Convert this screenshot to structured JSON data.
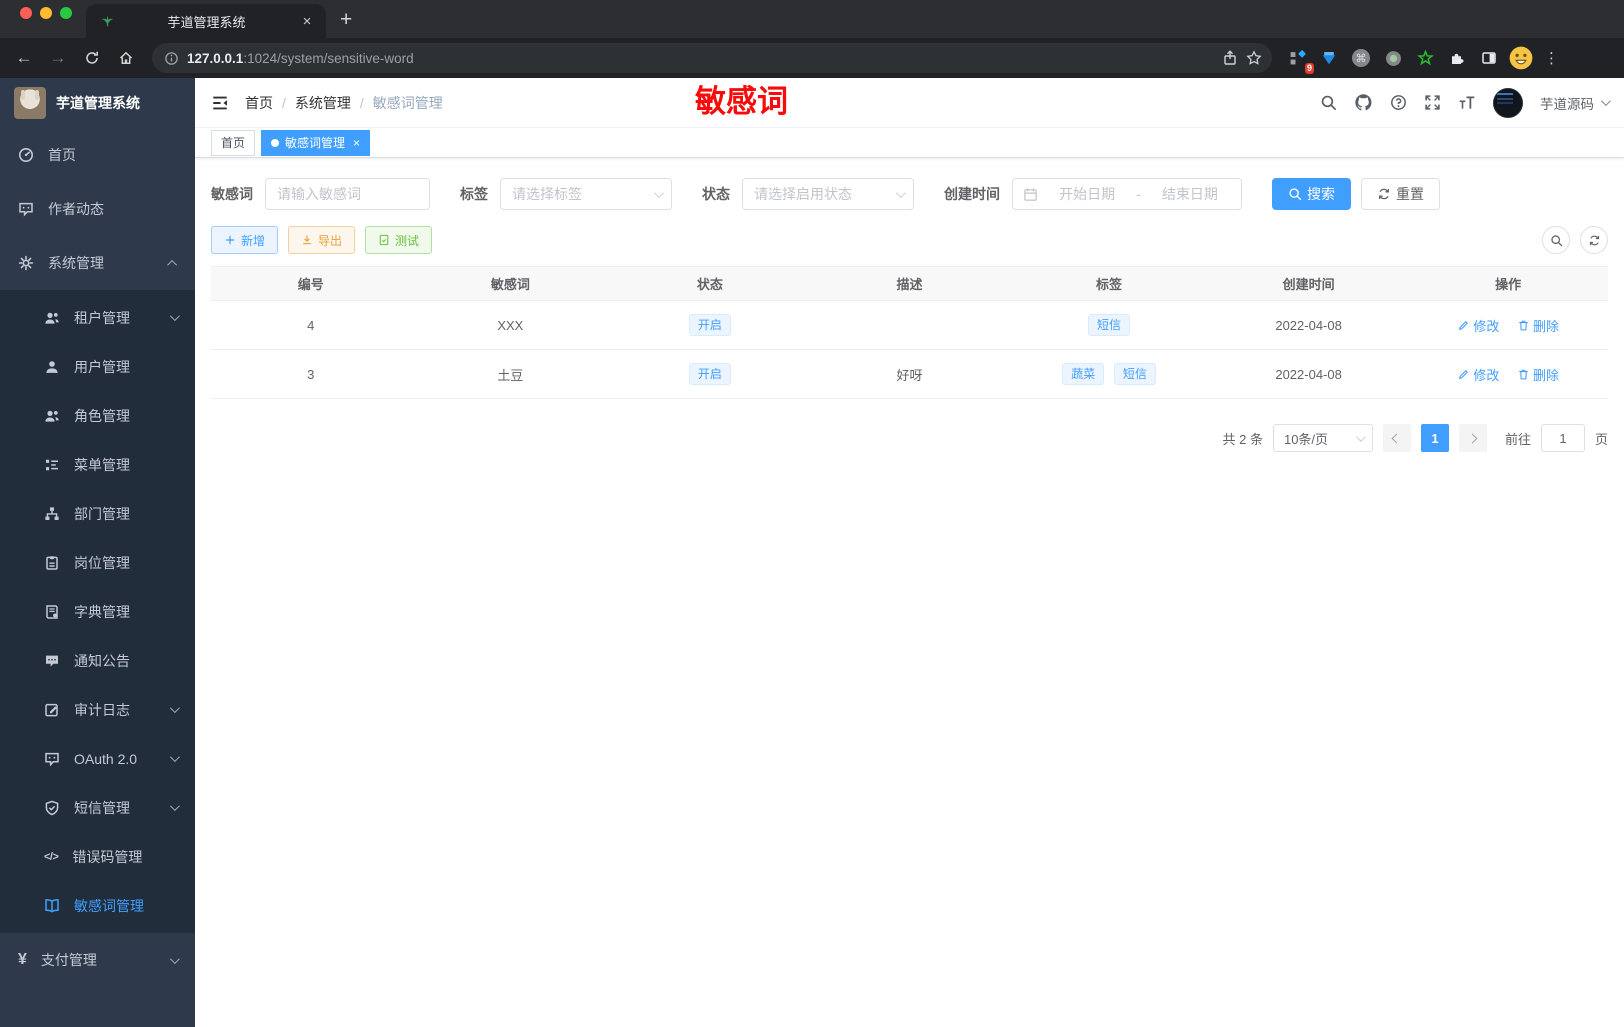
{
  "browser": {
    "tab_title": "芋道管理系统",
    "url_host": "127.0.0.1",
    "url_rest": ":1024/system/sensitive-word",
    "extension_badge": "9",
    "icons": {
      "new_tab": "+",
      "close_tab": "×",
      "back": "←",
      "forward": "→",
      "kebab": "⋮",
      "command": "⌘"
    }
  },
  "sidebar": {
    "logo_title": "芋道管理系统",
    "items": [
      {
        "label": "首页"
      },
      {
        "label": "作者动态"
      },
      {
        "label": "系统管理"
      },
      {
        "label": "租户管理"
      },
      {
        "label": "用户管理"
      },
      {
        "label": "角色管理"
      },
      {
        "label": "菜单管理"
      },
      {
        "label": "部门管理"
      },
      {
        "label": "岗位管理"
      },
      {
        "label": "字典管理"
      },
      {
        "label": "通知公告"
      },
      {
        "label": "审计日志"
      },
      {
        "label": "OAuth 2.0"
      },
      {
        "label": "短信管理"
      },
      {
        "label": "错误码管理"
      },
      {
        "label": "敏感词管理"
      },
      {
        "label": "支付管理"
      }
    ],
    "yen_glyph": "¥",
    "code_glyph": "</>"
  },
  "header": {
    "breadcrumb": [
      "首页",
      "系统管理",
      "敏感词管理"
    ],
    "separator": "/",
    "annotation": "敏感词",
    "username": "芋道源码"
  },
  "tabsbar": {
    "tabs": [
      {
        "label": "首页",
        "active": false
      },
      {
        "label": "敏感词管理",
        "active": true
      }
    ],
    "close_glyph": "×"
  },
  "filters": {
    "keyword_label": "敏感词",
    "keyword_placeholder": "请输入敏感词",
    "tag_label": "标签",
    "tag_placeholder": "请选择标签",
    "status_label": "状态",
    "status_placeholder": "请选择启用状态",
    "date_label": "创建时间",
    "date_start_placeholder": "开始日期",
    "date_separator": "-",
    "date_end_placeholder": "结束日期",
    "search_label": "搜索",
    "reset_label": "重置"
  },
  "toolbar": {
    "add_label": "新增",
    "export_label": "导出",
    "test_label": "测试"
  },
  "table": {
    "columns": [
      "编号",
      "敏感词",
      "状态",
      "描述",
      "标签",
      "创建时间",
      "操作"
    ],
    "rows": [
      {
        "id": "4",
        "word": "XXX",
        "status": "开启",
        "description": "",
        "tags": [
          "短信"
        ],
        "created": "2022-04-08",
        "edit": "修改",
        "delete": "删除"
      },
      {
        "id": "3",
        "word": "土豆",
        "status": "开启",
        "description": "好呀",
        "tags": [
          "蔬菜",
          "短信"
        ],
        "created": "2022-04-08",
        "edit": "修改",
        "delete": "删除"
      }
    ]
  },
  "pagination": {
    "total": "共 2 条",
    "page_size": "10条/页",
    "current_page": "1",
    "goto_label": "前往",
    "goto_value": "1",
    "page_label": "页"
  },
  "colors": {
    "accent": "#409eff",
    "annotation_red": "#f70b0b",
    "warning": "#e6a23c",
    "success": "#67c23a",
    "sidebar_bg": "#2e3a4c",
    "submenu_bg": "#222d3c"
  }
}
